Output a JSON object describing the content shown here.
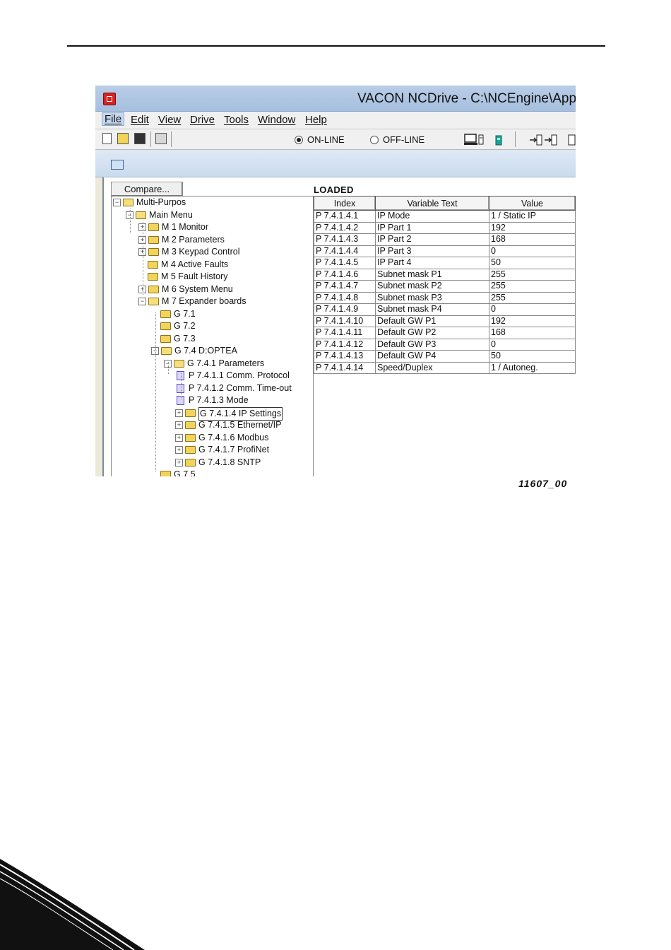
{
  "window": {
    "title": "VACON NCDrive - C:\\NCEngine\\Appli"
  },
  "menu": [
    "File",
    "Edit",
    "View",
    "Drive",
    "Tools",
    "Window",
    "Help"
  ],
  "toolbar": {
    "online_label": "ON-LINE",
    "offline_label": "OFF-LINE",
    "mode_selected": "ON-LINE"
  },
  "compare_label": "Compare...",
  "status_label": "LOADED",
  "tree": [
    {
      "label": "Multi-Purpos",
      "expander": "minus",
      "icon": "folder-open"
    },
    {
      "label": "Main Menu",
      "expander": "minus",
      "icon": "folder-open"
    },
    {
      "label": "M 1 Monitor",
      "expander": "plus",
      "icon": "folder"
    },
    {
      "label": "M 2 Parameters",
      "expander": "plus",
      "icon": "folder"
    },
    {
      "label": "M 3 Keypad Control",
      "expander": "plus",
      "icon": "folder"
    },
    {
      "label": "M 4 Active Faults",
      "expander": "none",
      "icon": "folder"
    },
    {
      "label": "M 5 Fault History",
      "expander": "none",
      "icon": "folder"
    },
    {
      "label": "M 6 System Menu",
      "expander": "plus",
      "icon": "folder"
    },
    {
      "label": "M 7 Expander boards",
      "expander": "minus",
      "icon": "folder-open"
    },
    {
      "label": "G 7.1",
      "expander": "none",
      "icon": "folder"
    },
    {
      "label": "G 7.2",
      "expander": "none",
      "icon": "folder"
    },
    {
      "label": "G 7.3",
      "expander": "none",
      "icon": "folder"
    },
    {
      "label": "G 7.4 D:OPTEA",
      "expander": "minus",
      "icon": "folder-open"
    },
    {
      "label": "G 7.4.1 Parameters",
      "expander": "minus",
      "icon": "folder-open"
    },
    {
      "label": "P 7.4.1.1 Comm. Protocol",
      "expander": "none",
      "icon": "document"
    },
    {
      "label": "P 7.4.1.2 Comm. Time-out",
      "expander": "none",
      "icon": "document"
    },
    {
      "label": "P 7.4.1.3 Mode",
      "expander": "none",
      "icon": "document"
    },
    {
      "label": "G 7.4.1.4 IP Settings",
      "expander": "plus",
      "icon": "folder",
      "selected": true
    },
    {
      "label": "G 7.4.1.5 Ethernet/IP",
      "expander": "plus",
      "icon": "folder"
    },
    {
      "label": "G 7.4.1.6 Modbus",
      "expander": "plus",
      "icon": "folder"
    },
    {
      "label": "G 7.4.1.7 ProfiNet",
      "expander": "plus",
      "icon": "folder"
    },
    {
      "label": "G 7.4.1.8 SNTP",
      "expander": "plus",
      "icon": "folder"
    },
    {
      "label": "G 7.5",
      "expander": "none",
      "icon": "folder"
    }
  ],
  "table": {
    "headers": [
      "Index",
      "Variable Text",
      "Value"
    ],
    "rows": [
      [
        "P 7.4.1.4.1",
        "IP Mode",
        "1 / Static IP"
      ],
      [
        "P 7.4.1.4.2",
        "IP Part 1",
        "192"
      ],
      [
        "P 7.4.1.4.3",
        "IP Part 2",
        "168"
      ],
      [
        "P 7.4.1.4.4",
        "IP Part 3",
        "0"
      ],
      [
        "P 7.4.1.4.5",
        "IP Part 4",
        "50"
      ],
      [
        "P 7.4.1.4.6",
        "Subnet mask P1",
        "255"
      ],
      [
        "P 7.4.1.4.7",
        "Subnet mask P2",
        "255"
      ],
      [
        "P 7.4.1.4.8",
        "Subnet mask P3",
        "255"
      ],
      [
        "P 7.4.1.4.9",
        "Subnet mask P4",
        "0"
      ],
      [
        "P 7.4.1.4.10",
        "Default GW P1",
        "192"
      ],
      [
        "P 7.4.1.4.11",
        "Default GW P2",
        "168"
      ],
      [
        "P 7.4.1.4.12",
        "Default GW P3",
        "0"
      ],
      [
        "P 7.4.1.4.13",
        "Default GW P4",
        "50"
      ],
      [
        "P 7.4.1.4.14",
        "Speed/Duplex",
        "1 / Autoneg."
      ]
    ]
  },
  "figure_code": "11607_00",
  "colors": {
    "titlebar": "#b9cde6",
    "app_icon": "#d62222",
    "folder": "#f2d45a",
    "document_icon": "#5a4fc8"
  }
}
